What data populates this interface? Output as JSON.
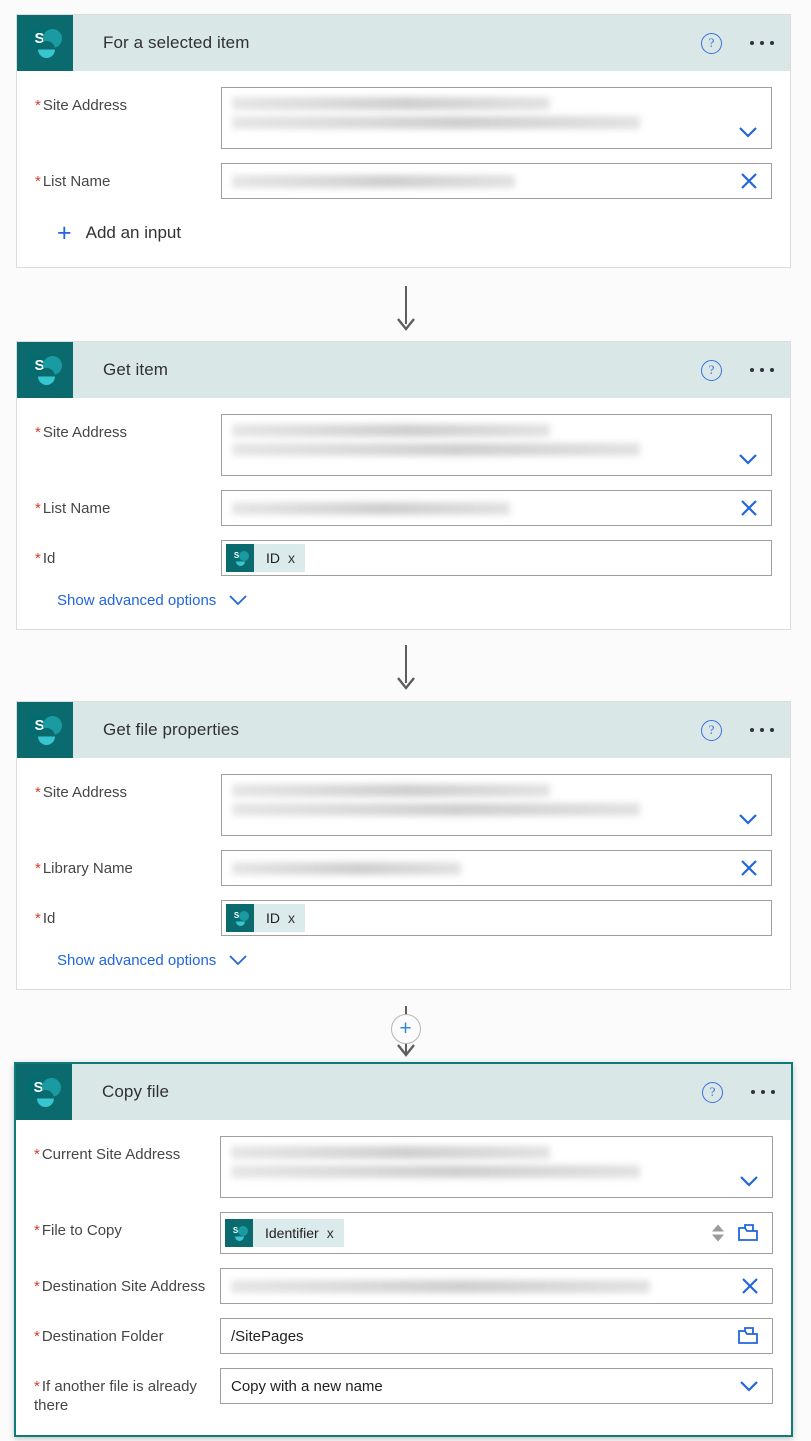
{
  "theme": {
    "header_bg": "#d9e7e7",
    "logo_bg": "#0b6a6e",
    "accent_blue": "#2266dd",
    "selected_border": "#0b7b7b",
    "required_star": "#d23b2e"
  },
  "icons": {
    "help": "?",
    "ellipsis": "...",
    "plus": "+",
    "chevron_down": "chevron-down-icon",
    "clear": "X",
    "folder": "folder-picker-icon",
    "token_remove": "x"
  },
  "cards": [
    {
      "id": "for-a-selected-item",
      "title": "For a selected item",
      "fields": [
        {
          "label": "Site Address",
          "required": true,
          "value_type": "redacted-multiline",
          "trailing_icon": "chevron-down-icon"
        },
        {
          "label": "List Name",
          "required": true,
          "value_type": "redacted",
          "trailing_icon": "clear-icon"
        }
      ],
      "add_input_label": "Add an input",
      "advanced_options_label": null
    },
    {
      "id": "get-item",
      "title": "Get item",
      "fields": [
        {
          "label": "Site Address",
          "required": true,
          "value_type": "redacted-multiline",
          "trailing_icon": "chevron-down-icon"
        },
        {
          "label": "List Name",
          "required": true,
          "value_type": "redacted",
          "trailing_icon": "clear-icon"
        },
        {
          "label": "Id",
          "required": true,
          "value_type": "token",
          "token_label": "ID",
          "trailing_icon": null
        }
      ],
      "add_input_label": null,
      "advanced_options_label": "Show advanced options"
    },
    {
      "id": "get-file-properties",
      "title": "Get file properties",
      "fields": [
        {
          "label": "Site Address",
          "required": true,
          "value_type": "redacted-multiline",
          "trailing_icon": "chevron-down-icon"
        },
        {
          "label": "Library Name",
          "required": true,
          "value_type": "redacted",
          "trailing_icon": "clear-icon"
        },
        {
          "label": "Id",
          "required": true,
          "value_type": "token",
          "token_label": "ID",
          "trailing_icon": null
        }
      ],
      "add_input_label": null,
      "advanced_options_label": "Show advanced options"
    },
    {
      "id": "copy-file",
      "title": "Copy file",
      "selected": true,
      "fields": [
        {
          "label": "Current Site Address",
          "required": true,
          "value_type": "redacted-multiline",
          "trailing_icon": "chevron-down-icon"
        },
        {
          "label": "File to Copy",
          "required": true,
          "value_type": "token",
          "token_label": "Identifier",
          "trailing_icon": "spinner-folder"
        },
        {
          "label": "Destination Site Address",
          "required": true,
          "value_type": "redacted",
          "trailing_icon": "clear-icon"
        },
        {
          "label": "Destination Folder",
          "required": true,
          "value_type": "text",
          "value": "/SitePages",
          "trailing_icon": "folder-icon"
        },
        {
          "label": "If another file is already there",
          "required": true,
          "value_type": "text",
          "value": "Copy with a new name",
          "trailing_icon": "chevron-down-icon"
        }
      ],
      "add_input_label": null,
      "advanced_options_label": null
    }
  ]
}
